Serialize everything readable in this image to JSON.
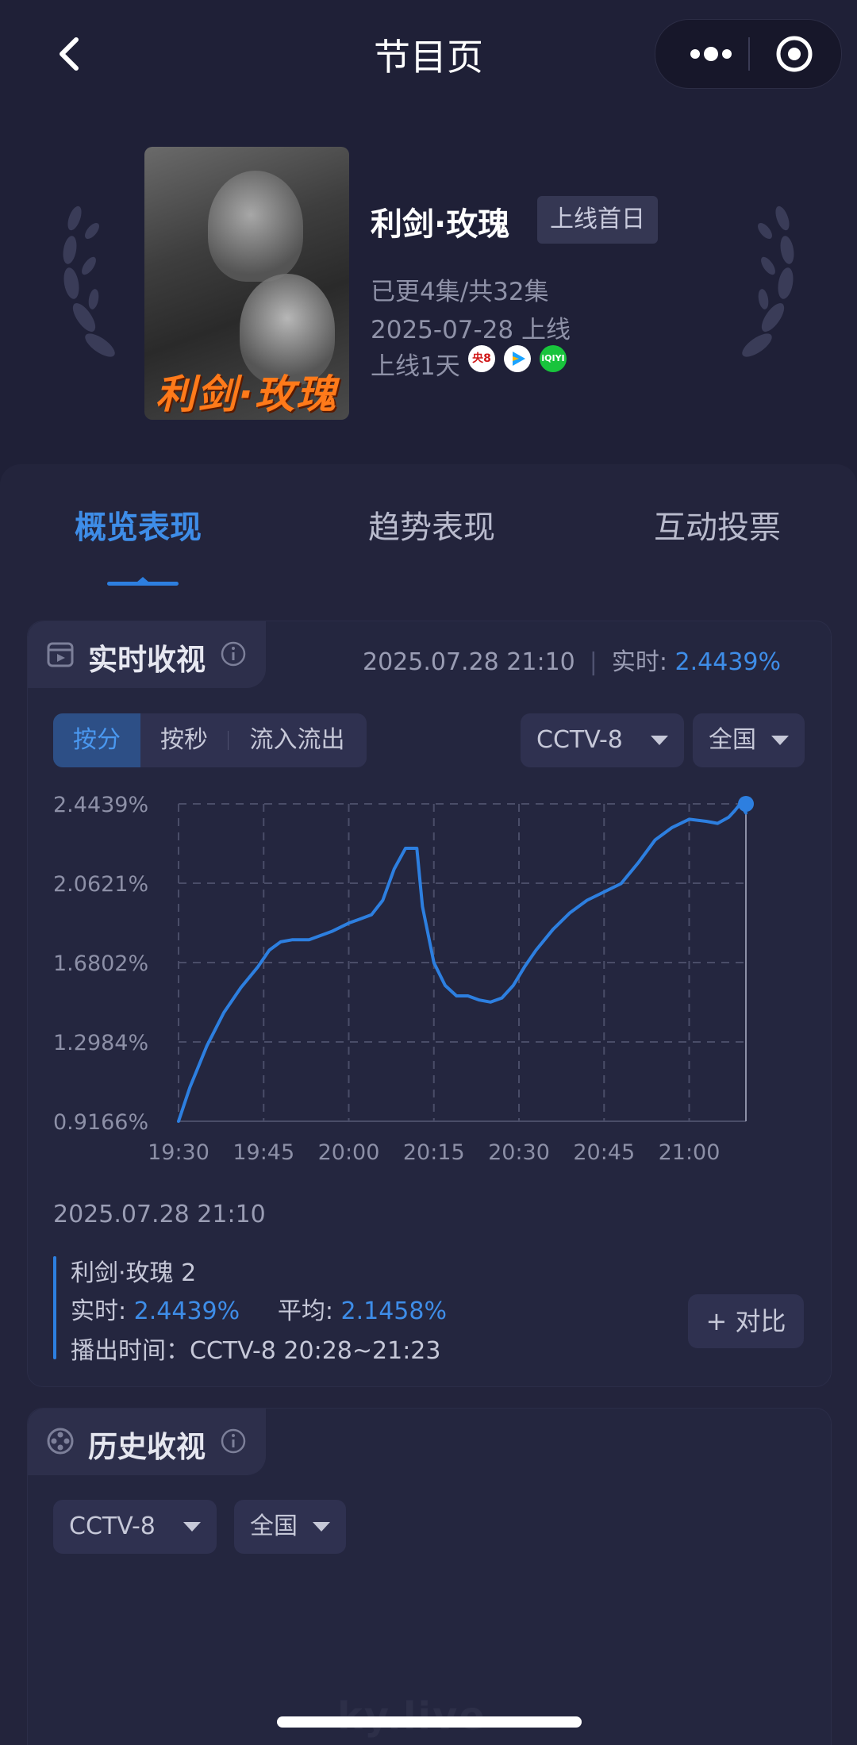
{
  "header": {
    "title": "节目页",
    "back_icon": "chevron-left-icon",
    "more_icon": "more-dots-icon",
    "target_icon": "target-icon"
  },
  "show": {
    "poster_text": "利剑·玫瑰",
    "title": "利剑·玫瑰",
    "badge": "上线首日",
    "episodes": "已更4集/共32集",
    "release": "2025-07-28 上线",
    "days_online": "上线1天",
    "platforms": [
      {
        "name": "cctv8-icon",
        "label": "央8"
      },
      {
        "name": "tencent-video-icon",
        "label": ""
      },
      {
        "name": "iqiyi-icon",
        "label": "iQIYI"
      }
    ]
  },
  "tabs": [
    {
      "label": "概览表现",
      "active": true
    },
    {
      "label": "趋势表现",
      "active": false
    },
    {
      "label": "互动投票",
      "active": false
    }
  ],
  "realtime": {
    "title": "实时收视",
    "datetime": "2025.07.28 21:10",
    "realtime_label": "实时:",
    "realtime_value": "2.4439%",
    "segments": [
      "按分",
      "按秒",
      "流入流出"
    ],
    "channel": "CCTV-8",
    "region": "全国",
    "tooltip": {
      "time": "2025.07.28 21:10",
      "name": "利剑·玫瑰 2",
      "realtime_label": "实时:",
      "realtime_value": "2.4439%",
      "avg_label": "平均:",
      "avg_value": "2.1458%",
      "air_time": "播出时间：CCTV-8 20:28~21:23"
    },
    "compare_button": "+ 对比"
  },
  "history": {
    "title": "历史收视",
    "channel": "CCTV-8",
    "region": "全国"
  },
  "watermark": "ky.live",
  "colors": {
    "accent": "#3e8de8",
    "background": "#1f2037",
    "card": "#24263f"
  },
  "chart_data": {
    "type": "line",
    "title": "",
    "xlabel": "",
    "ylabel": "",
    "x_ticks": [
      "19:30",
      "19:45",
      "20:00",
      "20:15",
      "20:30",
      "20:45",
      "21:00"
    ],
    "y_ticks": [
      "0.9166%",
      "1.2984%",
      "1.6802%",
      "2.0621%",
      "2.4439%"
    ],
    "ylim": [
      0.9166,
      2.4439
    ],
    "xlim": [
      "19:30",
      "21:10"
    ],
    "grid": true,
    "series": [
      {
        "name": "",
        "color": "#2d7fe0",
        "x": [
          "19:30",
          "19:32",
          "19:35",
          "19:38",
          "19:41",
          "19:44",
          "19:46",
          "19:48",
          "19:50",
          "19:53",
          "19:55",
          "19:57",
          "20:00",
          "20:02",
          "20:04",
          "20:06",
          "20:08",
          "20:10",
          "20:12",
          "20:13",
          "20:15",
          "20:17",
          "20:19",
          "20:21",
          "20:23",
          "20:25",
          "20:27",
          "20:29",
          "20:31",
          "20:33",
          "20:36",
          "20:39",
          "20:42",
          "20:45",
          "20:48",
          "20:51",
          "20:54",
          "20:57",
          "21:00",
          "21:03",
          "21:05",
          "21:07",
          "21:08",
          "21:09",
          "21:10"
        ],
        "values": [
          0.9166,
          1.08,
          1.28,
          1.44,
          1.56,
          1.66,
          1.74,
          1.78,
          1.79,
          1.79,
          1.81,
          1.83,
          1.87,
          1.89,
          1.91,
          1.98,
          2.13,
          2.23,
          2.23,
          1.95,
          1.68,
          1.57,
          1.52,
          1.52,
          1.5,
          1.49,
          1.51,
          1.57,
          1.66,
          1.74,
          1.84,
          1.92,
          1.98,
          2.02,
          2.06,
          2.16,
          2.27,
          2.33,
          2.37,
          2.36,
          2.35,
          2.38,
          2.41,
          2.4439,
          2.4
        ]
      }
    ],
    "highlight": {
      "x": "21:10",
      "value": 2.4439
    }
  }
}
